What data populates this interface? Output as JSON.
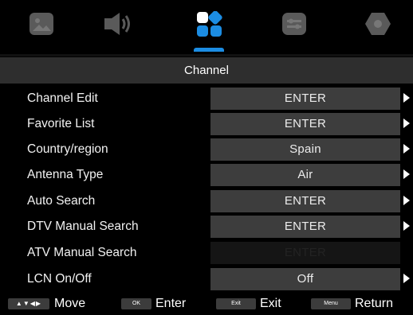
{
  "top_tabs": [
    {
      "icon": "picture-icon"
    },
    {
      "icon": "sound-icon"
    },
    {
      "icon": "channel-icon",
      "active": true
    },
    {
      "icon": "setup-icon"
    },
    {
      "icon": "lock-icon"
    }
  ],
  "header": {
    "title": "Channel"
  },
  "menu": {
    "items": [
      {
        "label": "Channel Edit",
        "value": "ENTER",
        "arrow": true
      },
      {
        "label": "Favorite List",
        "value": "ENTER",
        "arrow": true
      },
      {
        "label": "Country/region",
        "value": "Spain",
        "arrow": true
      },
      {
        "label": "Antenna Type",
        "value": "Air",
        "arrow": true
      },
      {
        "label": "Auto Search",
        "value": "ENTER",
        "arrow": true
      },
      {
        "label": "DTV Manual Search",
        "value": "ENTER",
        "arrow": true
      },
      {
        "label": "ATV Manual Search",
        "value": "ENTER",
        "arrow": false,
        "disabled": true
      },
      {
        "label": "LCN On/Off",
        "value": "Off",
        "arrow": true
      }
    ]
  },
  "footer": {
    "move_key": "▲▼◀▶",
    "move_label": "Move",
    "ok_key": "OK",
    "enter_label": "Enter",
    "exit_key": "Exit",
    "exit_label": "Exit",
    "menu_key": "Menu",
    "return_label": "Return"
  },
  "colors": {
    "accent": "#1c8de3",
    "icon_inactive": "#5a5a5a",
    "row_value_bg": "#3d3d3d",
    "header_bg": "#2e2e2e"
  }
}
